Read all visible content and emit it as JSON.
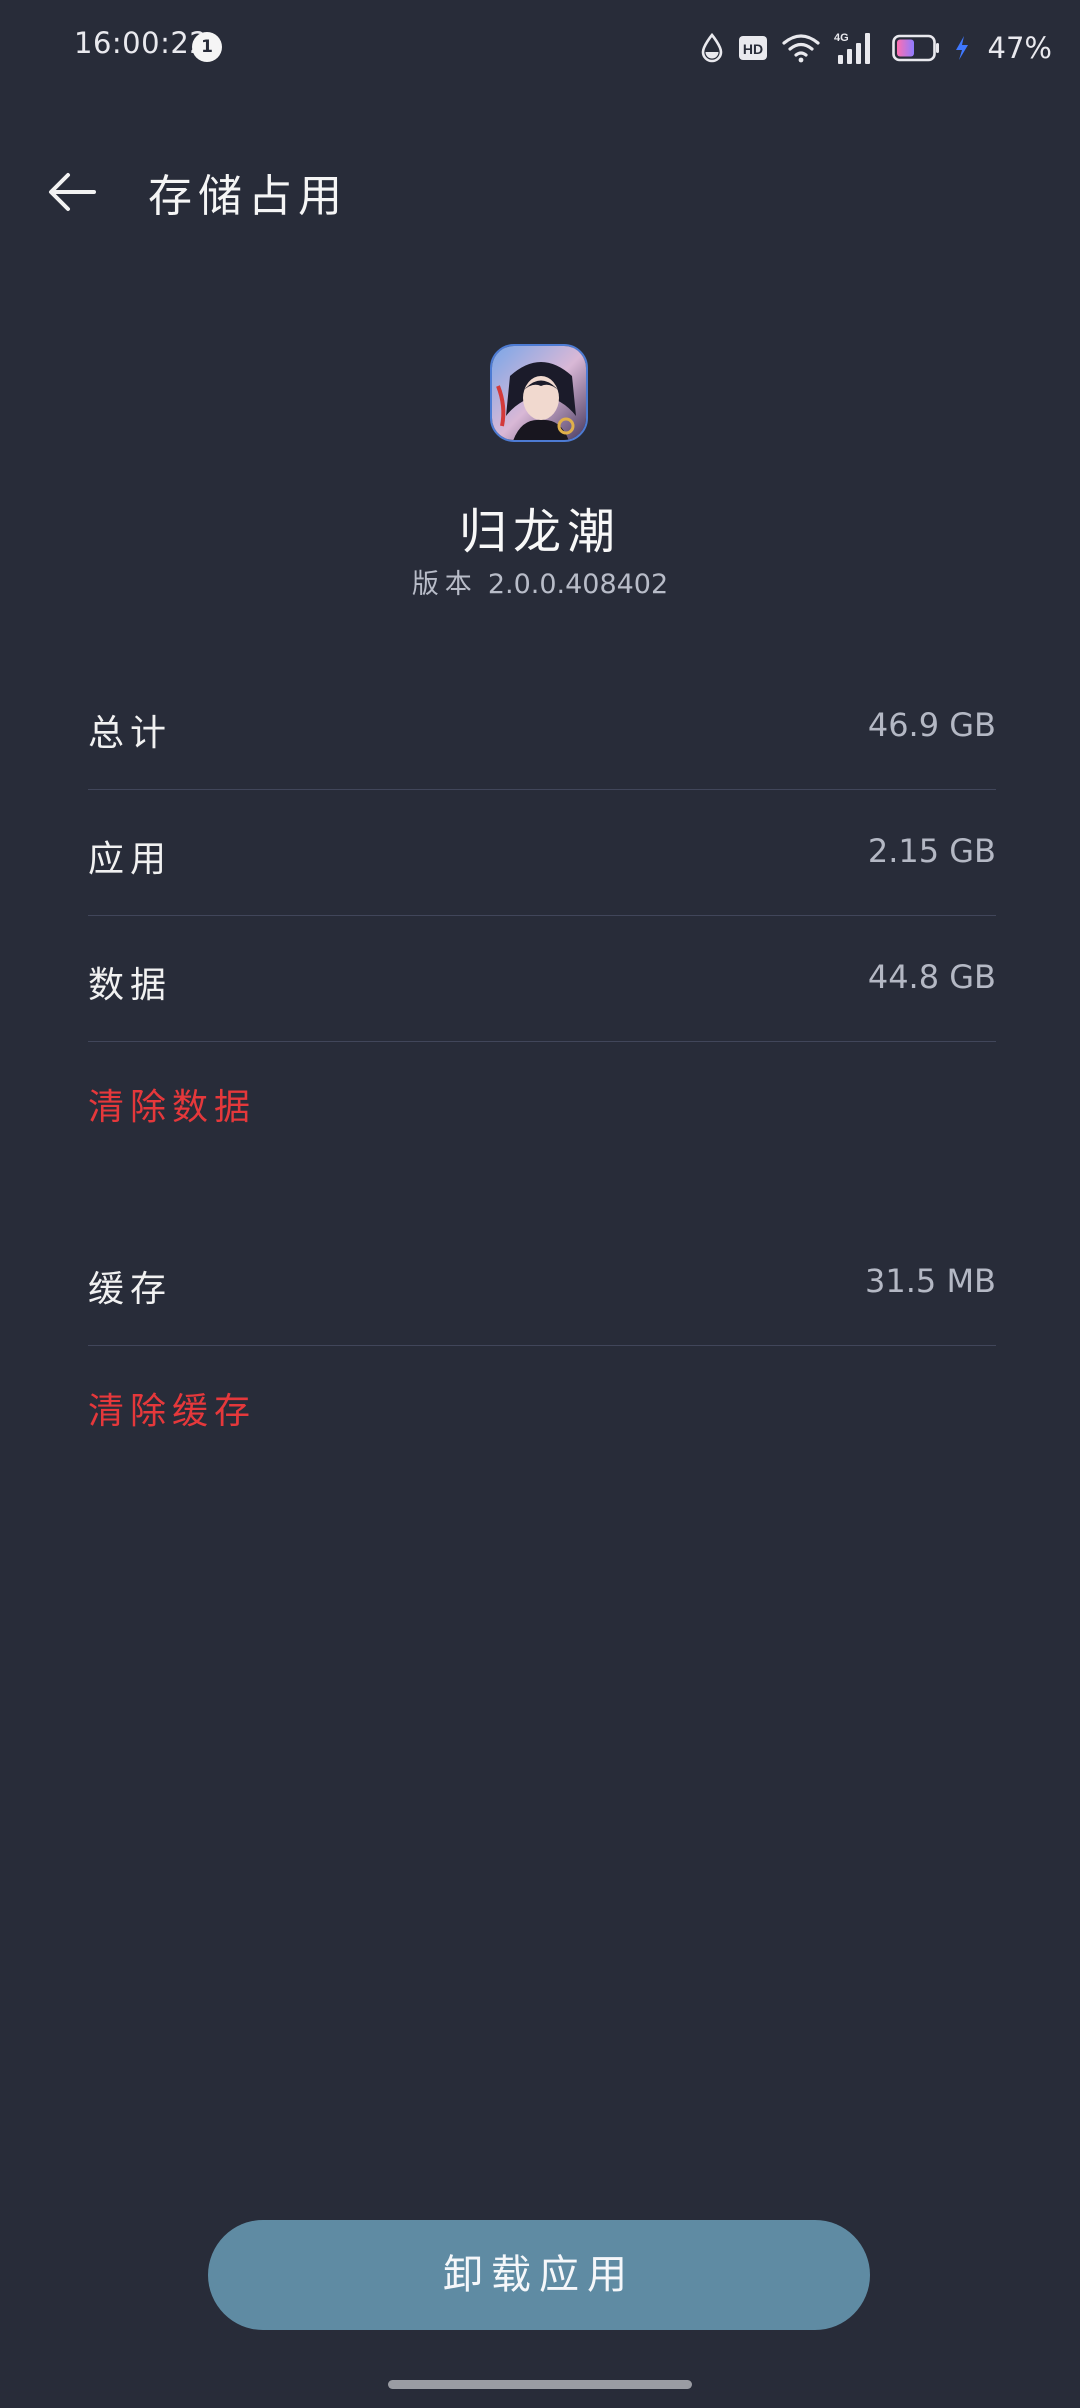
{
  "status_bar": {
    "time": "16:00:22",
    "notification_count": "1",
    "network": "4G",
    "hd_label": "HD",
    "battery_percent": "47%"
  },
  "header": {
    "title": "存储占用"
  },
  "app": {
    "name": "归龙潮",
    "version_label": "版本",
    "version_value": "2.0.0.408402"
  },
  "storage": {
    "rows": [
      {
        "label": "总计",
        "value": "46.9 GB"
      },
      {
        "label": "应用",
        "value": "2.15 GB"
      },
      {
        "label": "数据",
        "value": "44.8 GB"
      }
    ],
    "clear_data_label": "清除数据",
    "cache": {
      "label": "缓存",
      "value": "31.5 MB"
    },
    "clear_cache_label": "清除缓存"
  },
  "footer": {
    "uninstall_label": "卸载应用"
  },
  "colors": {
    "background": "#282c39",
    "accent_red": "#e5383b",
    "button": "#5f8ba3"
  }
}
